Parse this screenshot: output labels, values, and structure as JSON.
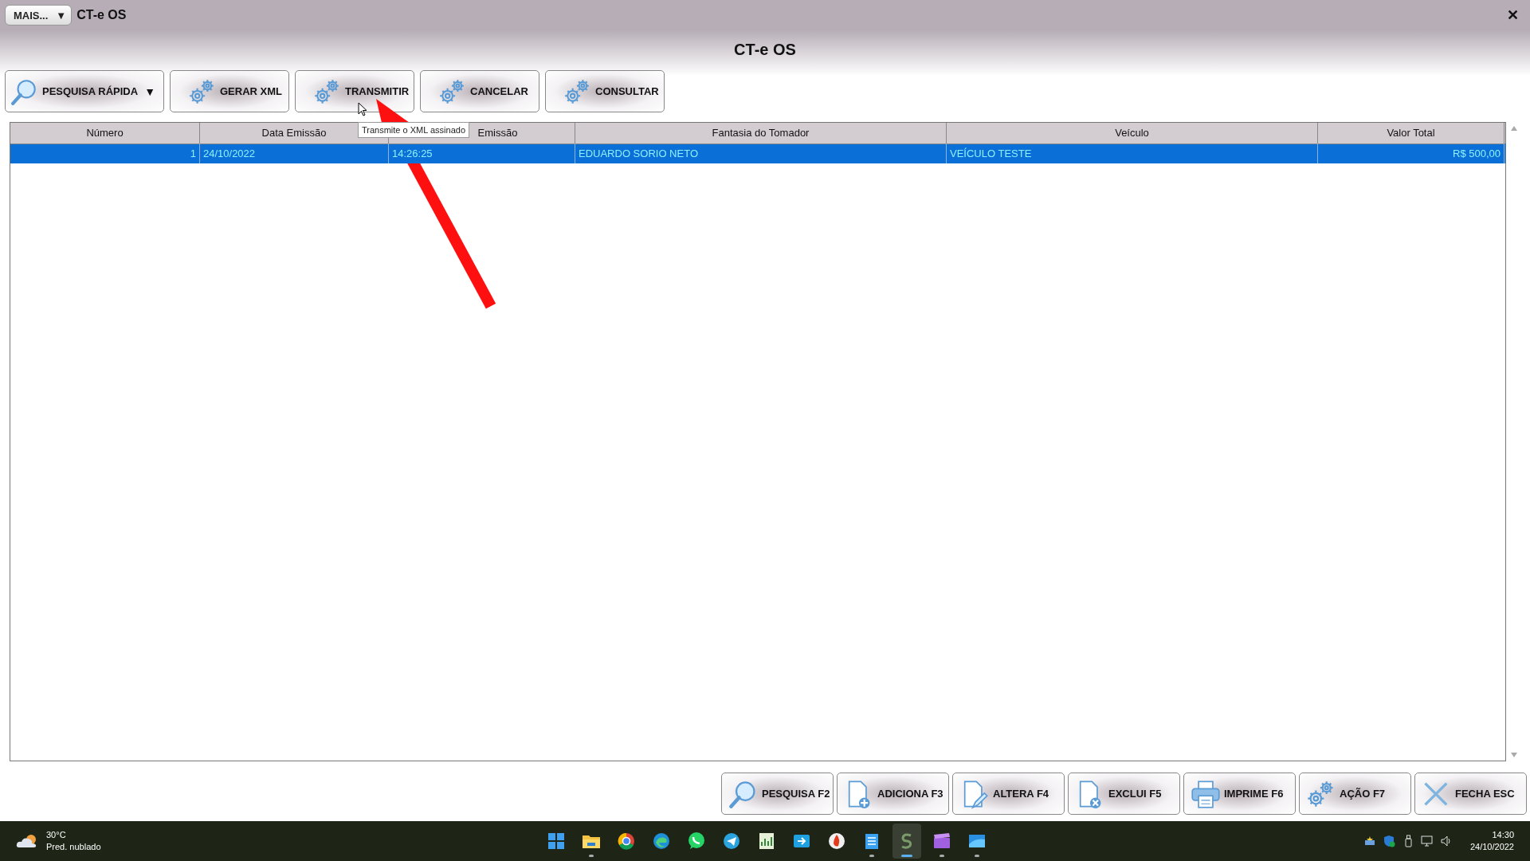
{
  "app": {
    "menu_button": "MAIS...",
    "menu_caret": "▼",
    "title": "CT-e OS",
    "close": "✕",
    "heading": "CT-e OS"
  },
  "toolbar": [
    {
      "label": "PESQUISA RÁPIDA",
      "kind": "search",
      "caret": "▼"
    },
    {
      "label": "GERAR XML",
      "kind": "gears"
    },
    {
      "label": "TRANSMITIR",
      "kind": "gears"
    },
    {
      "label": "CANCELAR",
      "kind": "gears"
    },
    {
      "label": "CONSULTAR",
      "kind": "gears"
    }
  ],
  "tooltip": "Transmite o XML assinado",
  "table": {
    "columns": [
      {
        "label": "Número",
        "kind": "number"
      },
      {
        "label": "Data Emissão",
        "kind": "text"
      },
      {
        "label": "Emissão",
        "kind": "text"
      },
      {
        "label": "Fantasia do Tomador",
        "kind": "text"
      },
      {
        "label": "Veículo",
        "kind": "text"
      },
      {
        "label": "Valor Total",
        "kind": "number"
      }
    ],
    "rows": [
      {
        "selected": true,
        "cells": [
          "1",
          "24/10/2022",
          "14:26:25",
          "EDUARDO SORIO NETO",
          "VEÍCULO TESTE",
          "R$ 500,00"
        ]
      }
    ]
  },
  "actions": [
    {
      "label": "PESQUISA F2",
      "kind": "search"
    },
    {
      "label": "ADICIONA F3",
      "kind": "add"
    },
    {
      "label": "ALTERA F4",
      "kind": "edit"
    },
    {
      "label": "EXCLUI F5",
      "kind": "remove"
    },
    {
      "label": "IMPRIME F6",
      "kind": "print"
    },
    {
      "label": "AÇÃO F7",
      "kind": "gears"
    },
    {
      "label": "FECHA ESC",
      "kind": "close"
    }
  ],
  "taskbar": {
    "temperature": "30°C",
    "forecast": "Pred. nublado",
    "apps": [
      {
        "kind": "windows",
        "running": false,
        "selected": false
      },
      {
        "kind": "folder",
        "running": true,
        "selected": false
      },
      {
        "kind": "chrome",
        "running": false,
        "selected": false
      },
      {
        "kind": "edge",
        "running": false,
        "selected": false
      },
      {
        "kind": "whatsapp",
        "running": false,
        "selected": false
      },
      {
        "kind": "telegram",
        "running": false,
        "selected": false
      },
      {
        "kind": "sheet",
        "running": false,
        "selected": false
      },
      {
        "kind": "share",
        "running": false,
        "selected": false
      },
      {
        "kind": "firebird",
        "running": false,
        "selected": false
      },
      {
        "kind": "notepad",
        "running": true,
        "selected": false
      },
      {
        "kind": "sg",
        "running": true,
        "selected": true
      },
      {
        "kind": "clapper",
        "running": true,
        "selected": false
      },
      {
        "kind": "window",
        "running": true,
        "selected": false
      }
    ],
    "time": "14:30",
    "date": "24/10/2022"
  }
}
